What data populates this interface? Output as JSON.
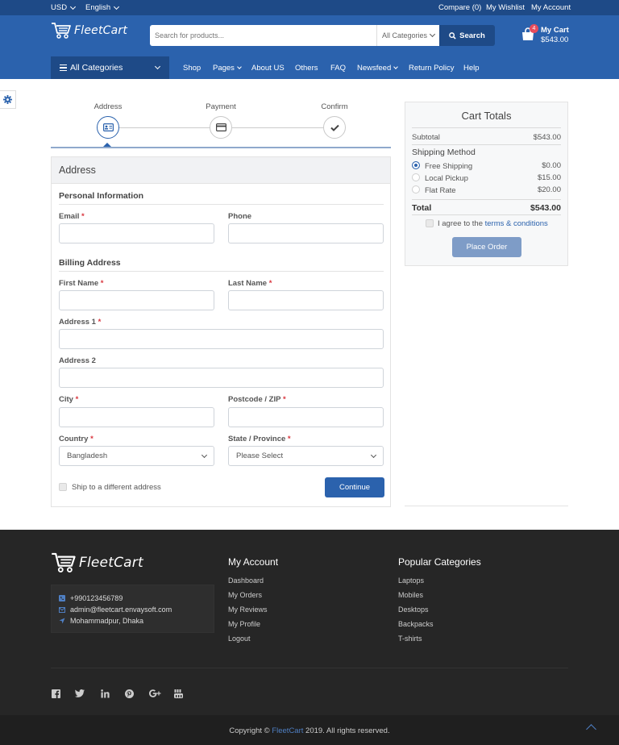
{
  "topbar": {
    "currency": "USD",
    "language": "English",
    "compare": "Compare (0)",
    "wishlist": "My Wishlist",
    "account": "My Account"
  },
  "header": {
    "logo": "FleetCart",
    "search_placeholder": "Search for products...",
    "search_category": "All Categories",
    "search_button": "Search",
    "cart_badge": "4",
    "cart_label": "My Cart",
    "cart_total": "$543.00"
  },
  "nav": {
    "all_categories": "All Categories",
    "items": [
      "Shop",
      "Pages",
      "About US",
      "Others",
      "FAQ",
      "Newsfeed",
      "Return Policy",
      "Help"
    ]
  },
  "steps": [
    "Address",
    "Payment",
    "Confirm"
  ],
  "form": {
    "title": "Address",
    "personal_section": "Personal Information",
    "email_label": "Email",
    "phone_label": "Phone",
    "billing_section": "Billing Address",
    "first_name_label": "First Name",
    "last_name_label": "Last Name",
    "address1_label": "Address 1",
    "address2_label": "Address 2",
    "city_label": "City",
    "postcode_label": "Postcode / ZIP",
    "country_label": "Country",
    "country_value": "Bangladesh",
    "state_label": "State / Province",
    "state_value": "Please Select",
    "ship_different": "Ship to a different address",
    "continue": "Continue",
    "required_mark": "*"
  },
  "cart_totals": {
    "title": "Cart Totals",
    "subtotal_label": "Subtotal",
    "subtotal_value": "$543.00",
    "shipping_label": "Shipping Method",
    "options": [
      {
        "label": "Free Shipping",
        "price": "$0.00"
      },
      {
        "label": "Local Pickup",
        "price": "$15.00"
      },
      {
        "label": "Flat Rate",
        "price": "$20.00"
      }
    ],
    "total_label": "Total",
    "total_value": "$543.00",
    "agree_prefix": "I agree to the",
    "agree_link": "terms & conditions",
    "place_order": "Place Order"
  },
  "footer": {
    "logo": "FleetCart",
    "phone": "+990123456789",
    "email": "admin@fleetcart.envaysoft.com",
    "address": "Mohammadpur, Dhaka",
    "my_account_title": "My Account",
    "my_account_links": [
      "Dashboard",
      "My Orders",
      "My Reviews",
      "My Profile",
      "Logout"
    ],
    "popular_title": "Popular Categories",
    "popular_links": [
      "Laptops",
      "Mobiles",
      "Desktops",
      "Backpacks",
      "T-shirts"
    ],
    "copyright_prefix": "Copyright ©",
    "copyright_brand": "FleetCart",
    "copyright_suffix": "2019. All rights reserved."
  },
  "colors": {
    "primary": "#2b62ad",
    "primary_dark": "#1e4a87",
    "footer_bg": "#262626"
  }
}
